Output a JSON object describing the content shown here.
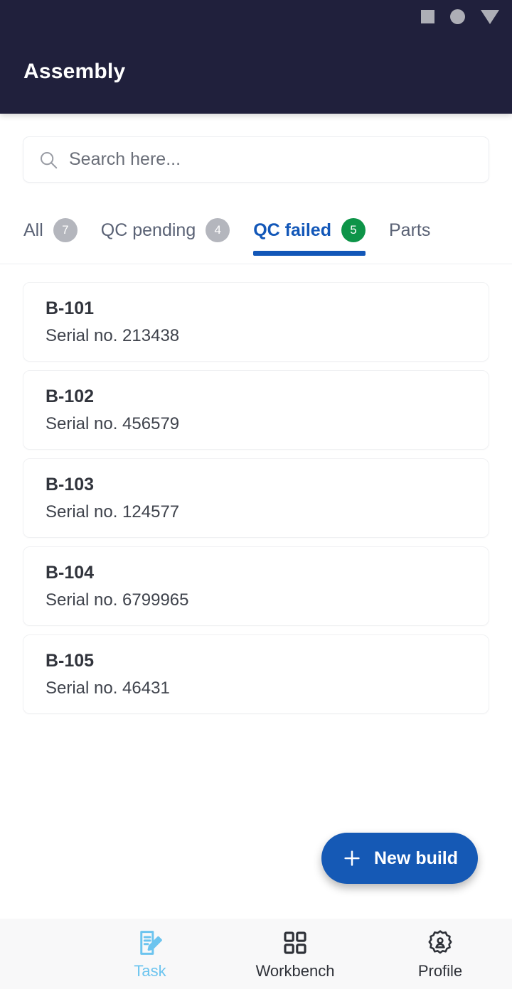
{
  "appbar": {
    "title": "Assembly",
    "system_nav": [
      {
        "name": "square-icon"
      },
      {
        "name": "circle-icon"
      },
      {
        "name": "triangle-icon"
      }
    ],
    "background_color": "#20203c"
  },
  "search": {
    "placeholder": "Search here...",
    "value": "",
    "icon": "search-icon"
  },
  "tabs": [
    {
      "label": "All",
      "count": "7",
      "active": false,
      "badge_color": "#b4b6bd"
    },
    {
      "label": "QC pending",
      "count": "4",
      "active": false,
      "badge_color": "#b4b6bd"
    },
    {
      "label": "QC failed",
      "count": "5",
      "active": true,
      "badge_color": "#0d9448"
    },
    {
      "label": "Parts",
      "count": "",
      "active": false,
      "badge_color": "#b4b6bd"
    }
  ],
  "builds": [
    {
      "title": "B-101",
      "serial": "Serial no. 213438"
    },
    {
      "title": "B-102",
      "serial": "Serial no. 456579"
    },
    {
      "title": "B-103",
      "serial": "Serial no. 124577"
    },
    {
      "title": "B-104",
      "serial": "Serial no. 6799965"
    },
    {
      "title": "B-105",
      "serial": "Serial no. 46431"
    }
  ],
  "fab": {
    "label": "New build",
    "icon": "plus-icon",
    "color": "#1559b5"
  },
  "bottom_nav": {
    "active_color": "#6cc4ef",
    "items": [
      {
        "label": "Task",
        "icon": "document-edit-icon",
        "active": true
      },
      {
        "label": "Workbench",
        "icon": "grid-icon",
        "active": false
      },
      {
        "label": "Profile",
        "icon": "gear-person-icon",
        "active": false
      }
    ]
  },
  "accent_color": "#1257b8"
}
